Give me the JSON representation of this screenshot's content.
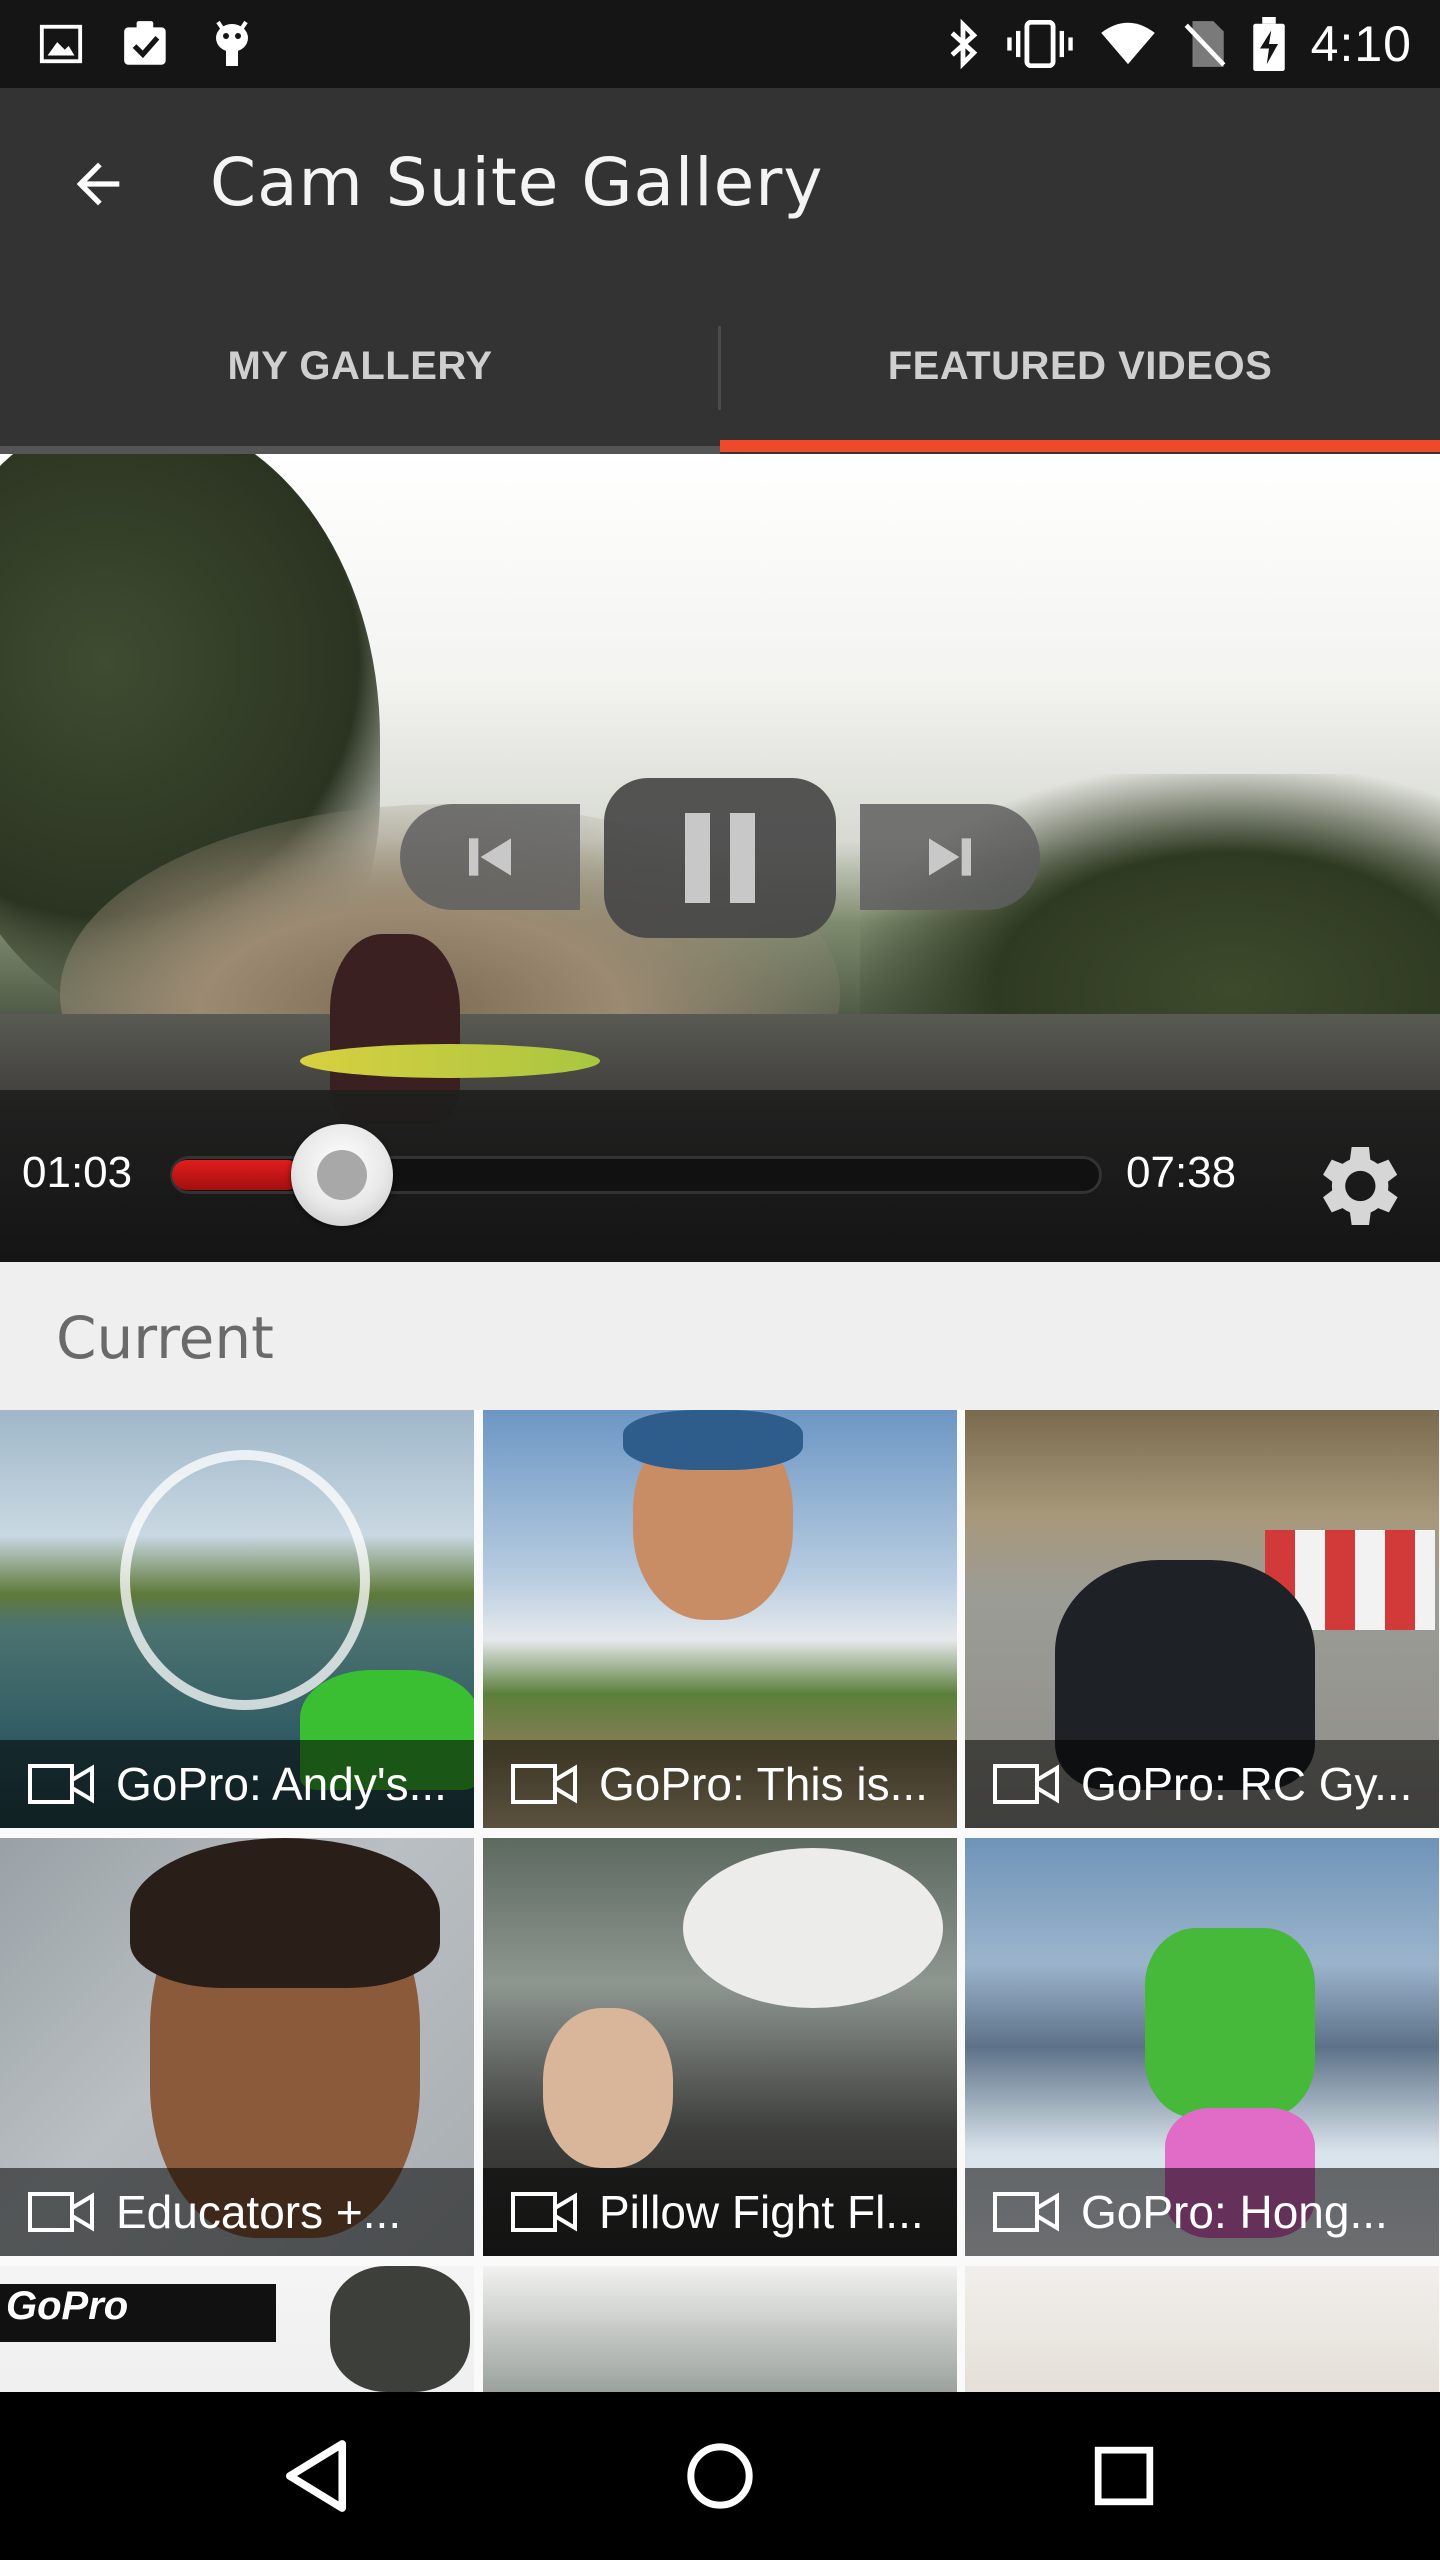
{
  "status_bar": {
    "time": "4:10",
    "left_icons": [
      "image-icon",
      "clipboard-check-icon",
      "android-debug-icon"
    ],
    "right_icons": [
      "bluetooth-icon",
      "vibrate-icon",
      "wifi-icon",
      "no-sim-icon",
      "battery-charging-icon"
    ]
  },
  "app_bar": {
    "title": "Cam Suite Gallery",
    "back_icon": "arrow-back-icon"
  },
  "tabs": [
    {
      "label": "MY GALLERY",
      "active": false
    },
    {
      "label": "FEATURED VIDEOS",
      "active": true
    }
  ],
  "colors": {
    "accent": "#ee4a2a",
    "app_bar": "#333333",
    "progress": "#e11d1d"
  },
  "player": {
    "current_time": "01:03",
    "total_time": "07:38",
    "progress_fraction": 0.14,
    "state": "playing",
    "controls": [
      "previous-icon",
      "pause-icon",
      "next-icon"
    ],
    "settings_icon": "gear-icon"
  },
  "section": {
    "title": "Current"
  },
  "videos": [
    {
      "title": "GoPro: Andy's..."
    },
    {
      "title": "GoPro: This is..."
    },
    {
      "title": "GoPro: RC Gy..."
    },
    {
      "title": "Educators +..."
    },
    {
      "title": "Pillow Fight Fl..."
    },
    {
      "title": "GoPro: Hong..."
    }
  ],
  "partial_tiles": {
    "logo_text": "GoPro"
  },
  "nav_bar": {
    "icons": [
      "back-triangle-icon",
      "home-circle-icon",
      "recents-square-icon"
    ]
  }
}
